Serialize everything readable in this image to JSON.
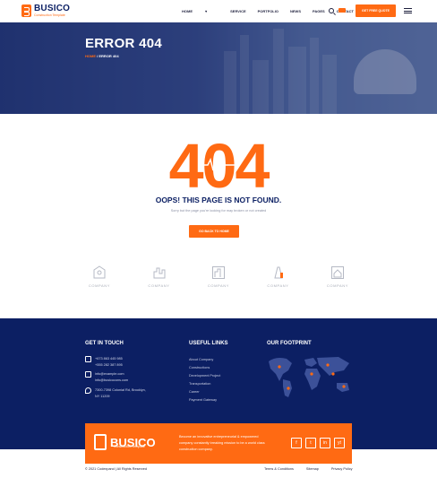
{
  "brand": {
    "name": "BUSICO",
    "tagline": "Construction Template"
  },
  "nav": {
    "items": [
      "HOME",
      "SERVICE",
      "PORTFOLIO",
      "NEWS",
      "PAGES",
      "CONTACT"
    ],
    "home_caret": "▾",
    "quote_button": "GET FREE QUOTE"
  },
  "hero": {
    "title": "ERROR 404",
    "breadcrumb_home": "HOME",
    "breadcrumb_sep": "/",
    "breadcrumb_current": "ERROR 404"
  },
  "error": {
    "code": "404",
    "heading": "OOPS! THIS PAGE IS NOT FOUND.",
    "message": "Sorry but the page you're looking for may broken or not created",
    "button": "GO BACK TO HOME"
  },
  "clients": [
    "COMPANY",
    "COMPANY",
    "COMPANY",
    "COMPANY",
    "COMPANY"
  ],
  "footer": {
    "contact_heading": "GET IN TOUCH",
    "phones": [
      "+673 863 445 985",
      "+555 282 387 895"
    ],
    "emails": [
      "info@example.com",
      "info@busicocons.com"
    ],
    "address": [
      "7300-7398 Colonial Rd, Brooklyn,",
      "NY 11209"
    ],
    "links_heading": "USEFUL LINKS",
    "links": [
      "About Company",
      "Constructions",
      "Development Project",
      "Transportation",
      "Career",
      "Payment Gateway"
    ],
    "footprint_heading": "OUR FOOTPRINT"
  },
  "cta": {
    "name": "BUSICO",
    "tagline": "Construction Template",
    "text": "Become an innovative entrepreneurial & empowered company constantly breaking mission to be a world class construction company.",
    "socials": [
      "f",
      "t",
      "in",
      "yt"
    ]
  },
  "bottom": {
    "copyright": "© 2021 Codexpand  |  All Rights Reserved",
    "links": [
      "Terms & Conditions",
      "Sitemap",
      "Privacy Policy"
    ]
  },
  "colors": {
    "accent": "#ff6a13",
    "navy": "#0c1f63"
  }
}
